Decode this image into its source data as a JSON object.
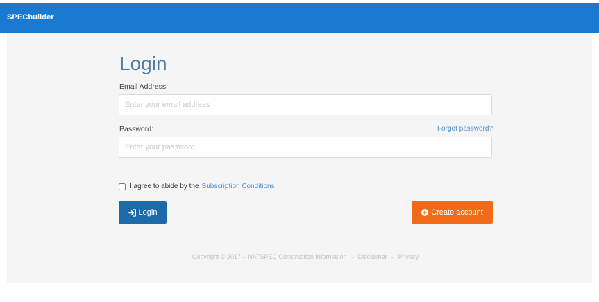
{
  "header": {
    "brand": "SPECbuilder",
    "bar_color": "#1a7ad1"
  },
  "form": {
    "title": "Login",
    "email_label": "Email Address",
    "email_placeholder": "Enter your email address",
    "password_label": "Password:",
    "password_placeholder": "Enter your password",
    "forgot_link": "Forgot password?",
    "agree_text": "I agree to abide by the",
    "agree_link": "Subscription Conditions",
    "login_button": "Login",
    "create_button": "Create account"
  },
  "footer": {
    "copyright": "Copyright © 2017 – NATSPEC Construction Information",
    "disclaimer": "Disclaimer",
    "privacy": "Privacy",
    "separator": "–"
  },
  "colors": {
    "accent": "#1a7ad1",
    "login_button": "#1d6aab",
    "create_button": "#f06b19",
    "link": "#4d8fd0",
    "title": "#4e7fa7"
  },
  "icons": {
    "login": "sign-in-icon",
    "create": "plus-circle-icon"
  }
}
